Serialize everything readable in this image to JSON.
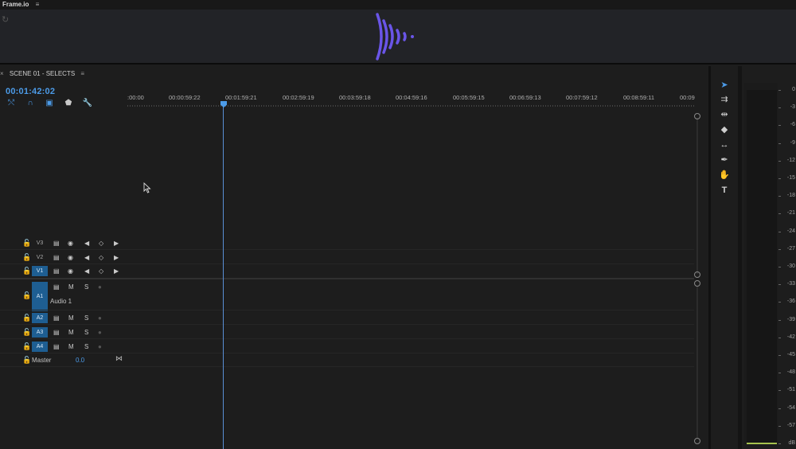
{
  "frameio": {
    "app_label": "Frame.io",
    "menu_icon": "hamburger-icon",
    "refresh_icon": "refresh-icon",
    "logo": "frameio-logo"
  },
  "sequence": {
    "close": "×",
    "name": "SCENE 01 - SELECTS",
    "menu": "≡",
    "timecode": "00:01:42:02",
    "tools": [
      "nest-icon",
      "snap-magnet-icon",
      "linked-selection-icon",
      "marker-icon",
      "wrench-icon"
    ]
  },
  "ruler": {
    "labels": [
      ":00:00",
      "00:00:59:22",
      "00:01:59:21",
      "00:02:59:19",
      "00:03:59:18",
      "00:04:59:16",
      "00:05:59:15",
      "00:06:59:13",
      "00:07:59:12",
      "00:08:59:11",
      "00:09"
    ]
  },
  "tracks": {
    "video": [
      {
        "name": "V3",
        "selected": false
      },
      {
        "name": "V2",
        "selected": false
      },
      {
        "name": "V1",
        "selected": true
      }
    ],
    "audio": [
      {
        "name": "A1",
        "label": "Audio 1",
        "m": "M",
        "s": "S"
      },
      {
        "name": "A2",
        "m": "M",
        "s": "S"
      },
      {
        "name": "A3",
        "m": "M",
        "s": "S"
      },
      {
        "name": "A4",
        "m": "M",
        "s": "S"
      }
    ],
    "master": {
      "label": "Master",
      "value": "0.0"
    }
  },
  "toolbar": [
    "selection-tool-icon",
    "track-select-tool-icon",
    "ripple-edit-tool-icon",
    "razor-tool-icon",
    "slip-tool-icon",
    "pen-tool-icon",
    "hand-tool-icon",
    "type-tool-icon"
  ],
  "meter": {
    "scale": [
      "0",
      "-3",
      "-6",
      "-9",
      "-12",
      "-15",
      "-18",
      "-21",
      "-24",
      "-27",
      "-30",
      "-33",
      "-36",
      "-39",
      "-42",
      "-45",
      "-48",
      "-51",
      "-54",
      "-57",
      "dB"
    ],
    "level_color": "#a6c34e"
  },
  "colors": {
    "accent": "#4c9be8",
    "selected_track": "#1e5e92",
    "logo": "#6a55e8"
  }
}
